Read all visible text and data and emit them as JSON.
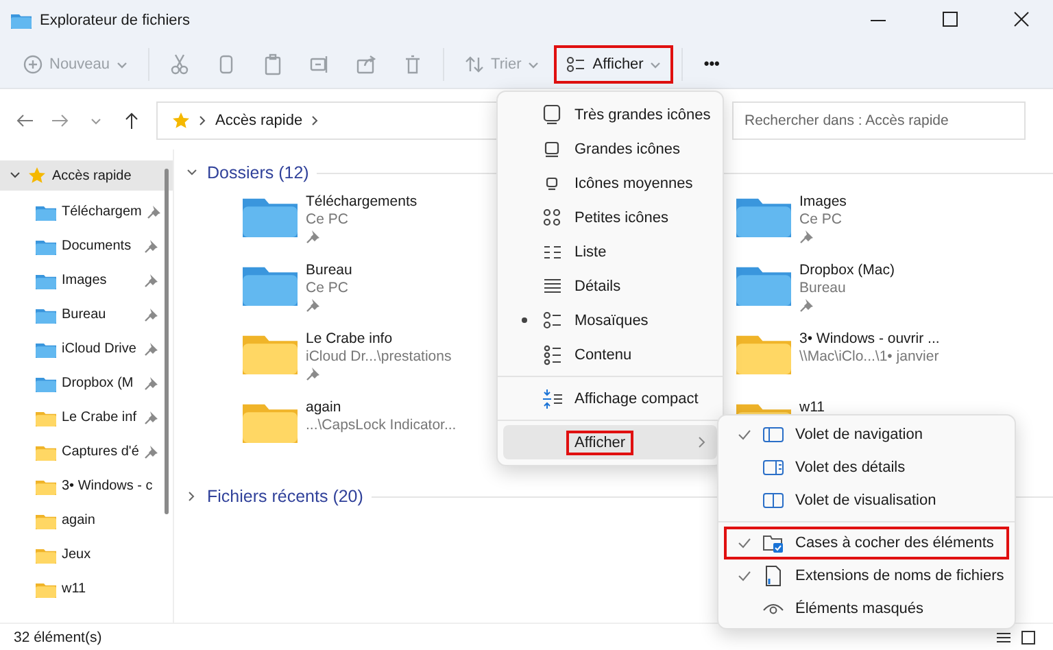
{
  "window": {
    "title": "Explorateur de fichiers"
  },
  "toolbar": [
    {
      "kind": "new",
      "label": "Nouveau",
      "disabled": true,
      "highlighted": false
    },
    {
      "kind": "icon",
      "disabled": true
    },
    {
      "kind": "icon",
      "disabled": true
    },
    {
      "kind": "icon",
      "disabled": true
    },
    {
      "kind": "icon",
      "disabled": true
    },
    {
      "kind": "icon",
      "disabled": true
    },
    {
      "kind": "icon",
      "disabled": true
    },
    {
      "kind": "sort",
      "label": "Trier",
      "disabled": true,
      "highlighted": false
    },
    {
      "kind": "view",
      "label": "Afficher",
      "disabled": false,
      "highlighted": true
    },
    {
      "kind": "more",
      "label": "•••",
      "disabled": false,
      "highlighted": false
    }
  ],
  "address": {
    "path": "Accès rapide"
  },
  "search": {
    "placeholder": "Rechercher dans : Accès rapide"
  },
  "sidebar": {
    "items": [
      {
        "label": "Accès rapide",
        "kind": "star",
        "selected": true,
        "expanded": true,
        "children": [
          {
            "label": "Téléchargem",
            "kind": "blue",
            "pinned": true,
            "selected": false
          },
          {
            "label": "Documents",
            "kind": "blue",
            "pinned": true,
            "selected": false
          },
          {
            "label": "Images",
            "kind": "blue",
            "pinned": true,
            "selected": false
          },
          {
            "label": "Bureau",
            "kind": "blue",
            "pinned": true,
            "selected": false
          },
          {
            "label": "iCloud Drive",
            "kind": "blue",
            "pinned": true,
            "selected": false
          },
          {
            "label": "Dropbox (M",
            "kind": "blue",
            "pinned": true,
            "selected": false
          },
          {
            "label": "Le Crabe inf",
            "kind": "yellow",
            "pinned": true,
            "selected": false
          },
          {
            "label": "Captures d'é",
            "kind": "yellow",
            "pinned": true,
            "selected": false
          },
          {
            "label": "3• Windows - c",
            "kind": "yellow",
            "pinned": false,
            "selected": false
          },
          {
            "label": "again",
            "kind": "yellow",
            "pinned": false,
            "selected": false
          },
          {
            "label": "Jeux",
            "kind": "yellow",
            "pinned": false,
            "selected": false
          },
          {
            "label": "w11",
            "kind": "yellow",
            "pinned": false,
            "selected": false
          }
        ]
      }
    ]
  },
  "sections": [
    {
      "title": "Dossiers (12)",
      "expanded": true,
      "folders": [
        {
          "name": "Téléchargements",
          "location": "Ce PC",
          "kind": "blue",
          "pinned": true
        },
        {
          "name": "Images",
          "location": "Ce PC",
          "kind": "blue",
          "pinned": true
        },
        {
          "name": "Bureau",
          "location": "Ce PC",
          "kind": "blue",
          "pinned": true
        },
        {
          "name": "Dropbox (Mac)",
          "location": "Bureau",
          "kind": "blue",
          "pinned": true
        },
        {
          "name": "Le Crabe info",
          "location": "iCloud Dr...\\prestations",
          "kind": "yellow",
          "pinned": true
        },
        {
          "name": "3• Windows - ouvrir ...",
          "location": "\\\\Mac\\iClo...\\1• janvier",
          "kind": "yellow",
          "pinned": false
        },
        {
          "name": "again",
          "location": "...\\CapsLock Indicator...",
          "kind": "yellow",
          "pinned": false
        },
        {
          "name": "w11",
          "kind": "yellow"
        }
      ]
    },
    {
      "title": "Fichiers récents (20)",
      "expanded": false
    }
  ],
  "view_menu": {
    "items": [
      {
        "kind": "option",
        "label": "Très grandes icônes",
        "selected": false
      },
      {
        "kind": "option",
        "label": "Grandes icônes",
        "selected": false
      },
      {
        "kind": "option",
        "label": "Icônes moyennes",
        "selected": false
      },
      {
        "kind": "option",
        "label": "Petites icônes",
        "selected": false
      },
      {
        "kind": "option",
        "label": "Liste",
        "selected": false
      },
      {
        "kind": "option",
        "label": "Détails",
        "selected": false
      },
      {
        "kind": "option",
        "label": "Mosaïques",
        "selected": true
      },
      {
        "kind": "option",
        "label": "Contenu",
        "selected": false
      },
      {
        "kind": "separator"
      },
      {
        "kind": "toggle",
        "label": "Affichage compact",
        "checked": false
      },
      {
        "kind": "separator"
      },
      {
        "kind": "submenu",
        "label": "Afficher",
        "hovered": true,
        "highlighted": true
      }
    ]
  },
  "show_submenu": {
    "items": [
      {
        "kind": "toggle",
        "label": "Volet de navigation",
        "checked": true,
        "highlighted": false
      },
      {
        "kind": "toggle",
        "label": "Volet des détails",
        "checked": false,
        "highlighted": false
      },
      {
        "kind": "toggle",
        "label": "Volet de visualisation",
        "checked": false,
        "highlighted": false
      },
      {
        "kind": "separator"
      },
      {
        "kind": "toggle",
        "label": "Cases à cocher des éléments",
        "checked": true,
        "highlighted": true
      },
      {
        "kind": "toggle",
        "label": "Extensions de noms de fichiers",
        "checked": true,
        "highlighted": false
      },
      {
        "kind": "toggle",
        "label": "Éléments masqués",
        "checked": false,
        "highlighted": false
      }
    ]
  },
  "status_bar": {
    "count": "32 élément(s)"
  }
}
